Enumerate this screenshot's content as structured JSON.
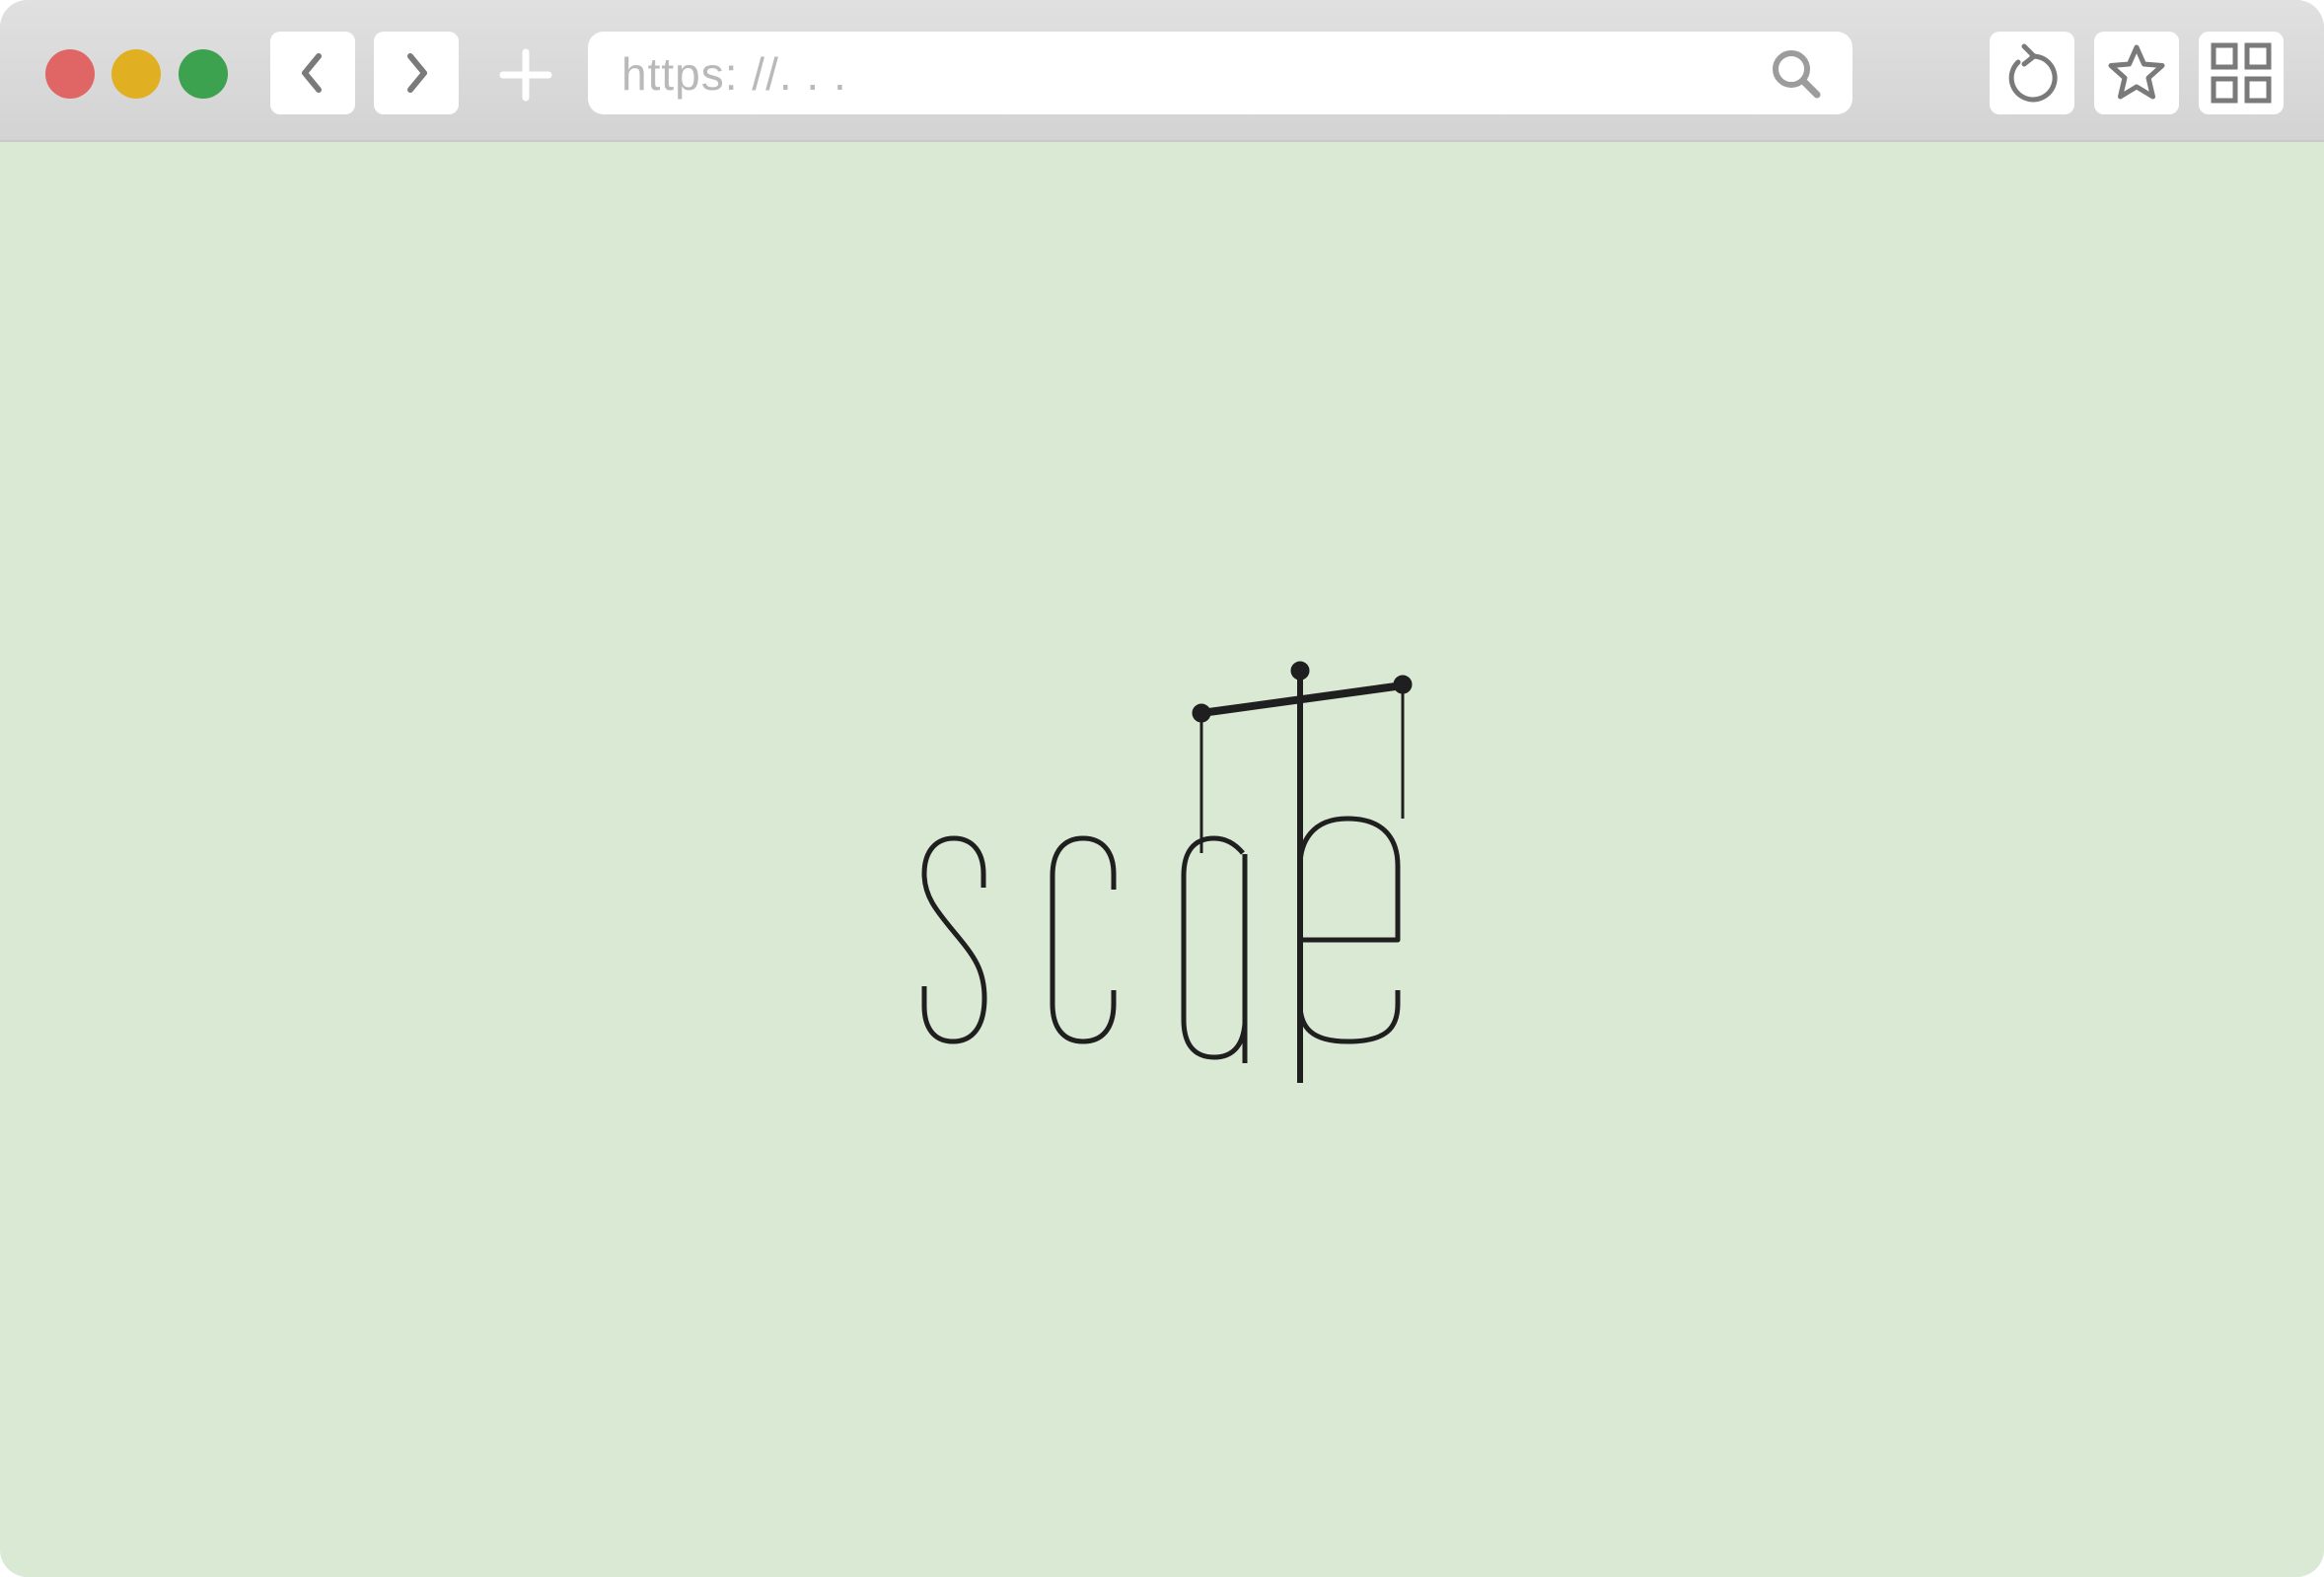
{
  "window": {
    "traffic_lights": {
      "close_color": "#e06666",
      "minimize_color": "#e0b022",
      "zoom_color": "#3da24f"
    }
  },
  "toolbar": {
    "back_icon": "chevron-left-icon",
    "forward_icon": "chevron-right-icon",
    "new_tab_icon": "plus-icon",
    "address_placeholder": "https: //. . .",
    "search_icon": "search-icon",
    "reload_icon": "reload-icon",
    "bookmark_icon": "star-icon",
    "tabs_overview_icon": "grid-icon"
  },
  "content": {
    "background_color": "#d9e9d3",
    "logo_text": "scale"
  }
}
